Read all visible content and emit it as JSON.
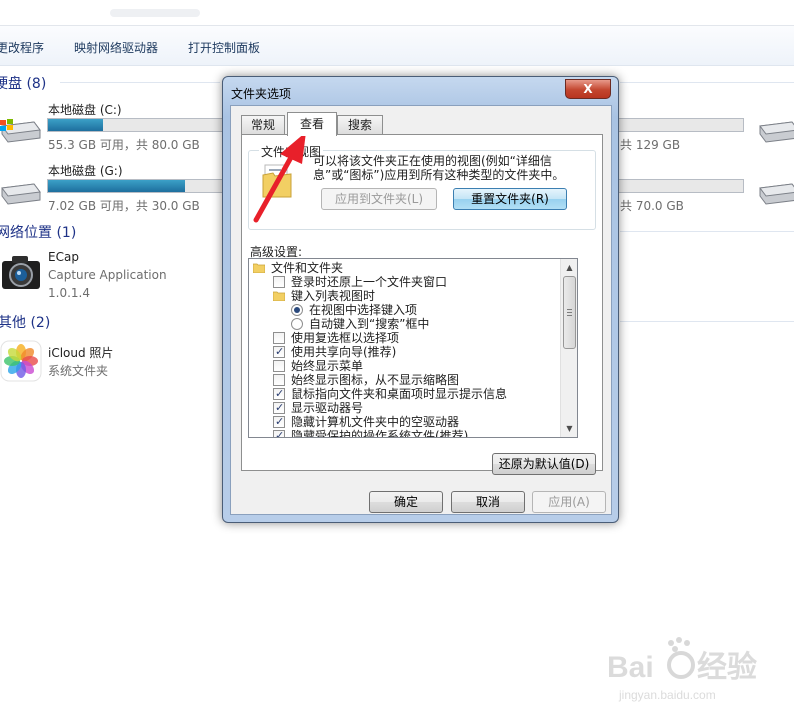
{
  "explorer": {
    "toolbar": [
      "更改程序",
      "映射网络驱动器",
      "打开控制面板"
    ],
    "groups": {
      "hard_disks": "硬盘 (8)",
      "network": "网络位置 (1)",
      "other": "其他 (2)"
    },
    "drives": [
      {
        "name": "本地磁盘 (C:)",
        "info": "55.3 GB 可用，共 80.0 GB",
        "used_fraction": 0.31
      },
      {
        "name": "本地磁盘 (G:)",
        "info": "7.02 GB 可用，共 30.0 GB",
        "used_fraction": 0.77
      },
      {
        "name": "",
        "info": "共 129 GB",
        "used_fraction": 0.0
      },
      {
        "name": "",
        "info": "共 70.0 GB",
        "used_fraction": 0.0
      }
    ],
    "network_item": {
      "name": "ECap",
      "line2": "Capture Application",
      "line3": "1.0.1.4"
    },
    "other_item": {
      "name": "iCloud 照片",
      "line2": "系统文件夹"
    }
  },
  "dialog": {
    "title": "文件夹选项",
    "close_label": "X",
    "tabs": [
      "常规",
      "查看",
      "搜索"
    ],
    "active_tab": 1,
    "folder_views": {
      "legend": "文件夹视图",
      "description": "可以将该文件夹正在使用的视图(例如“详细信息”或“图标”)应用到所有这种类型的文件夹中。",
      "apply_button": "应用到文件夹(L)",
      "reset_button": "重置文件夹(R)"
    },
    "advanced_label": "高级设置:",
    "advanced_items": [
      {
        "type": "folder",
        "label": "文件和文件夹"
      },
      {
        "type": "checkbox",
        "checked": false,
        "label": "登录时还原上一个文件夹窗口"
      },
      {
        "type": "folder",
        "label": "键入列表视图时"
      },
      {
        "type": "radio",
        "checked": true,
        "label": "在视图中选择键入项"
      },
      {
        "type": "radio",
        "checked": false,
        "label": "自动键入到“搜索”框中"
      },
      {
        "type": "checkbox",
        "checked": false,
        "label": "使用复选框以选择项"
      },
      {
        "type": "checkbox",
        "checked": true,
        "label": "使用共享向导(推荐)"
      },
      {
        "type": "checkbox",
        "checked": false,
        "label": "始终显示菜单"
      },
      {
        "type": "checkbox",
        "checked": false,
        "label": "始终显示图标，从不显示缩略图"
      },
      {
        "type": "checkbox",
        "checked": true,
        "label": "鼠标指向文件夹和桌面项时显示提示信息"
      },
      {
        "type": "checkbox",
        "checked": true,
        "label": "显示驱动器号"
      },
      {
        "type": "checkbox",
        "checked": true,
        "label": "隐藏计算机文件夹中的空驱动器"
      },
      {
        "type": "checkbox",
        "checked": true,
        "label": "隐藏受保护的操作系统文件(推荐)"
      }
    ],
    "restore_defaults": "还原为默认值(D)",
    "ok": "确定",
    "cancel": "取消",
    "apply": "应用(A)"
  },
  "colors": {
    "annotation_arrow": "#e8202a",
    "drive_bar": "#2a86b6"
  }
}
